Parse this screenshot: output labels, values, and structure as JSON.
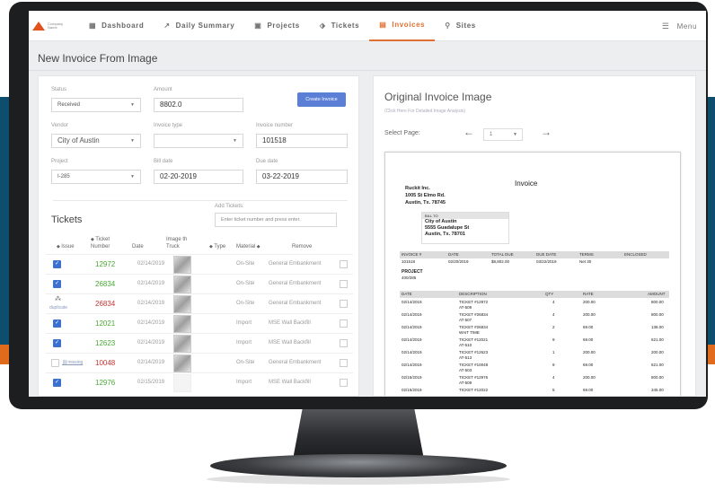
{
  "nav": {
    "logo_text": "Company Name",
    "items": [
      {
        "label": "Dashboard",
        "icon": "grid-icon"
      },
      {
        "label": "Daily Summary",
        "icon": "trend-icon"
      },
      {
        "label": "Projects",
        "icon": "folder-icon"
      },
      {
        "label": "Tickets",
        "icon": "ticket-icon"
      },
      {
        "label": "Invoices",
        "icon": "document-icon"
      },
      {
        "label": "Sites",
        "icon": "pin-icon"
      }
    ],
    "menu_label": "Menu"
  },
  "page_title": "New Invoice From Image",
  "form": {
    "status_label": "Status",
    "status_value": "Received",
    "amount_label": "Amount",
    "amount_value": "8802.0",
    "create_button": "Create Invoice",
    "vendor_label": "Vendor",
    "vendor_value": "City of Austin",
    "invoice_type_label": "Invoice type",
    "invoice_type_value": "",
    "invoice_number_label": "Invoice number",
    "invoice_number_value": "101518",
    "project_label": "Project",
    "project_value": "I-285",
    "bill_date_label": "Bill date",
    "bill_date_value": "02-20-2019",
    "due_date_label": "Due date",
    "due_date_value": "03-22-2019"
  },
  "tickets": {
    "title": "Tickets",
    "add_label": "Add Tickets:",
    "add_placeholder": "Enter ticket number and press enter.",
    "headers": {
      "issue": "Issue",
      "ticket_number": "Ticket Number",
      "date": "Date",
      "image": "Image th Truck",
      "type": "Type",
      "material": "Material",
      "remove": "Remove"
    },
    "rows": [
      {
        "issue": "",
        "number": "12972",
        "color": "green",
        "date": "02/14/2019",
        "type": "On-Site",
        "material": "General Embankment",
        "checked": true
      },
      {
        "issue": "",
        "number": "26834",
        "color": "green",
        "date": "02/14/2019",
        "type": "On-Site",
        "material": "General Embankment",
        "checked": true
      },
      {
        "issue": "duplicate",
        "number": "26834",
        "color": "red",
        "date": "02/14/2019",
        "type": "On-Site",
        "material": "General Embankment",
        "checked": false
      },
      {
        "issue": "",
        "number": "12021",
        "color": "green",
        "date": "02/14/2019",
        "type": "Import",
        "material": "MSE Wall Backfill",
        "checked": true
      },
      {
        "issue": "",
        "number": "12623",
        "color": "green",
        "date": "02/14/2019",
        "type": "Import",
        "material": "MSE Wall Backfill",
        "checked": true
      },
      {
        "issue": "missing",
        "number": "10048",
        "color": "red",
        "date": "02/14/2019",
        "type": "On-Site",
        "material": "General Embankment",
        "checked": false
      },
      {
        "issue": "",
        "number": "12976",
        "color": "green",
        "date": "02/15/2019",
        "type": "Import",
        "material": "MSE Wall Backfill",
        "checked": true
      }
    ]
  },
  "image_panel": {
    "title": "Original Invoice Image",
    "subtitle": "(Click Here For Detailed Image Analysis)",
    "select_page_label": "Select Page:",
    "page_value": "1"
  },
  "invoice_doc": {
    "heading": "Invoice",
    "company": [
      "Ruckit Inc.",
      "1005 St Elmo Rd.",
      "Austin, Tx. 78745"
    ],
    "bill_to_label": "BILL TO",
    "bill_to": [
      "City of Austin",
      "5555 Guadalupe St",
      "Austin, Tx. 78701"
    ],
    "summary_headers": [
      "INVOICE #",
      "DATE",
      "TOTAL DUE",
      "DUE DATE",
      "TERMS",
      "ENCLOSED"
    ],
    "summary_values": [
      "101518",
      "02/20/2019",
      "$8,802.00",
      "03/22/2019",
      "Net 30",
      ""
    ],
    "project_label": "PROJECT",
    "project_value": "400/285",
    "line_headers": [
      "DATE",
      "DESCRIPTION",
      "QTY",
      "RATE",
      "AMOUNT"
    ],
    "lines": [
      {
        "date": "02/14/2019",
        "desc": "TICKET #12972",
        "desc2": "AT-509",
        "qty": "4",
        "rate": "200.00",
        "amount": "800.00"
      },
      {
        "date": "02/14/2019",
        "desc": "TICKET #26834",
        "desc2": "AT-507",
        "qty": "4",
        "rate": "200.00",
        "amount": "800.00"
      },
      {
        "date": "02/14/2019",
        "desc": "TICKET #26834",
        "desc2": "WAIT TIME",
        "qty": "2",
        "rate": "69.00",
        "amount": "138.00"
      },
      {
        "date": "02/14/2019",
        "desc": "TICKET #12021",
        "desc2": "AT-510",
        "qty": "9",
        "rate": "69.00",
        "amount": "621.00"
      },
      {
        "date": "02/14/2019",
        "desc": "TICKET #12623",
        "desc2": "AT-513",
        "qty": "1",
        "rate": "200.00",
        "amount": "200.00"
      },
      {
        "date": "02/14/2019",
        "desc": "TICKET #10048",
        "desc2": "AT-503",
        "qty": "9",
        "rate": "69.00",
        "amount": "621.00"
      },
      {
        "date": "02/15/2019",
        "desc": "TICKET #12976",
        "desc2": "AT-509",
        "qty": "4",
        "rate": "200.00",
        "amount": "800.00"
      },
      {
        "date": "02/15/2019",
        "desc": "TICKET #12022",
        "desc2": "",
        "qty": "5",
        "rate": "69.00",
        "amount": "345.00"
      }
    ]
  }
}
